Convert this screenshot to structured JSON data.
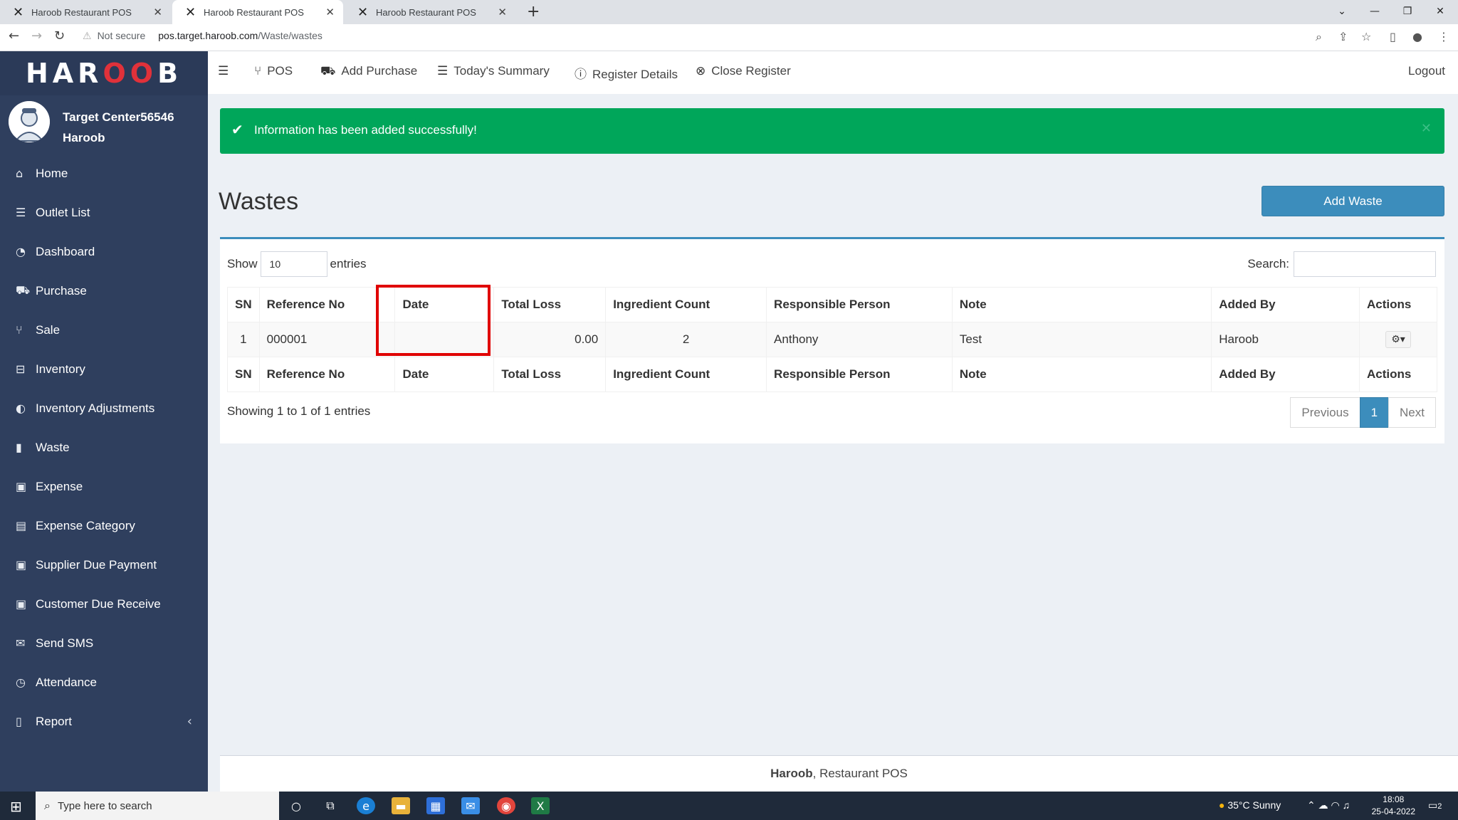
{
  "browser": {
    "tabs": [
      {
        "title": "Haroob Restaurant POS"
      },
      {
        "title": "Haroob Restaurant POS"
      },
      {
        "title": "Haroob Restaurant POS"
      }
    ],
    "security": "Not secure",
    "url_host": "pos.target.haroob.com",
    "url_path": "/Waste/wastes"
  },
  "sidebar": {
    "logo_left": "HAR",
    "logo_mid": "OO",
    "logo_right": "B",
    "outlet": "Target Center56546",
    "user": "Haroob",
    "items": [
      {
        "label": "Home",
        "icon": "home-icon"
      },
      {
        "label": "Outlet List",
        "icon": "list-icon"
      },
      {
        "label": "Dashboard",
        "icon": "dashboard-icon"
      },
      {
        "label": "Purchase",
        "icon": "truck-icon"
      },
      {
        "label": "Sale",
        "icon": "cutlery-icon"
      },
      {
        "label": "Inventory",
        "icon": "inbox-icon"
      },
      {
        "label": "Inventory Adjustments",
        "icon": "adjust-icon"
      },
      {
        "label": "Waste",
        "icon": "trash-icon"
      },
      {
        "label": "Expense",
        "icon": "money-icon"
      },
      {
        "label": "Expense Category",
        "icon": "list-alt-icon"
      },
      {
        "label": "Supplier Due Payment",
        "icon": "money-icon"
      },
      {
        "label": "Customer Due Receive",
        "icon": "money-icon"
      },
      {
        "label": "Send SMS",
        "icon": "envelope-icon"
      },
      {
        "label": "Attendance",
        "icon": "clock-icon"
      },
      {
        "label": "Report",
        "icon": "file-icon"
      }
    ]
  },
  "topnav": {
    "pos": "POS",
    "add_purchase": "Add Purchase",
    "todays_summary": "Today's Summary",
    "register_details": "Register Details",
    "close_register": "Close Register",
    "logout": "Logout"
  },
  "alert": {
    "message": "Information has been added successfully!"
  },
  "page": {
    "title": "Wastes",
    "add_button": "Add Waste"
  },
  "table": {
    "show_label": "Show",
    "page_size": "10",
    "entries_label": "entries",
    "search_label": "Search:",
    "columns": [
      "SN",
      "Reference No",
      "Date",
      "Total Loss",
      "Ingredient Count",
      "Responsible Person",
      "Note",
      "Added By",
      "Actions"
    ],
    "rows": [
      {
        "sn": "1",
        "ref": "000001",
        "date": "",
        "total_loss": "0.00",
        "ingredient_count": "2",
        "responsible": "Anthony",
        "note": "Test",
        "added_by": "Haroob"
      }
    ],
    "info": "Showing 1 to 1 of 1 entries",
    "pagination": {
      "previous": "Previous",
      "current": "1",
      "next": "Next"
    }
  },
  "footer": {
    "brand": "Haroob",
    "text": ", Restaurant POS"
  },
  "taskbar": {
    "search_placeholder": "Type here to search",
    "weather": "35°C  Sunny",
    "time": "18:08",
    "date": "25-04-2022",
    "notifications": "2"
  }
}
